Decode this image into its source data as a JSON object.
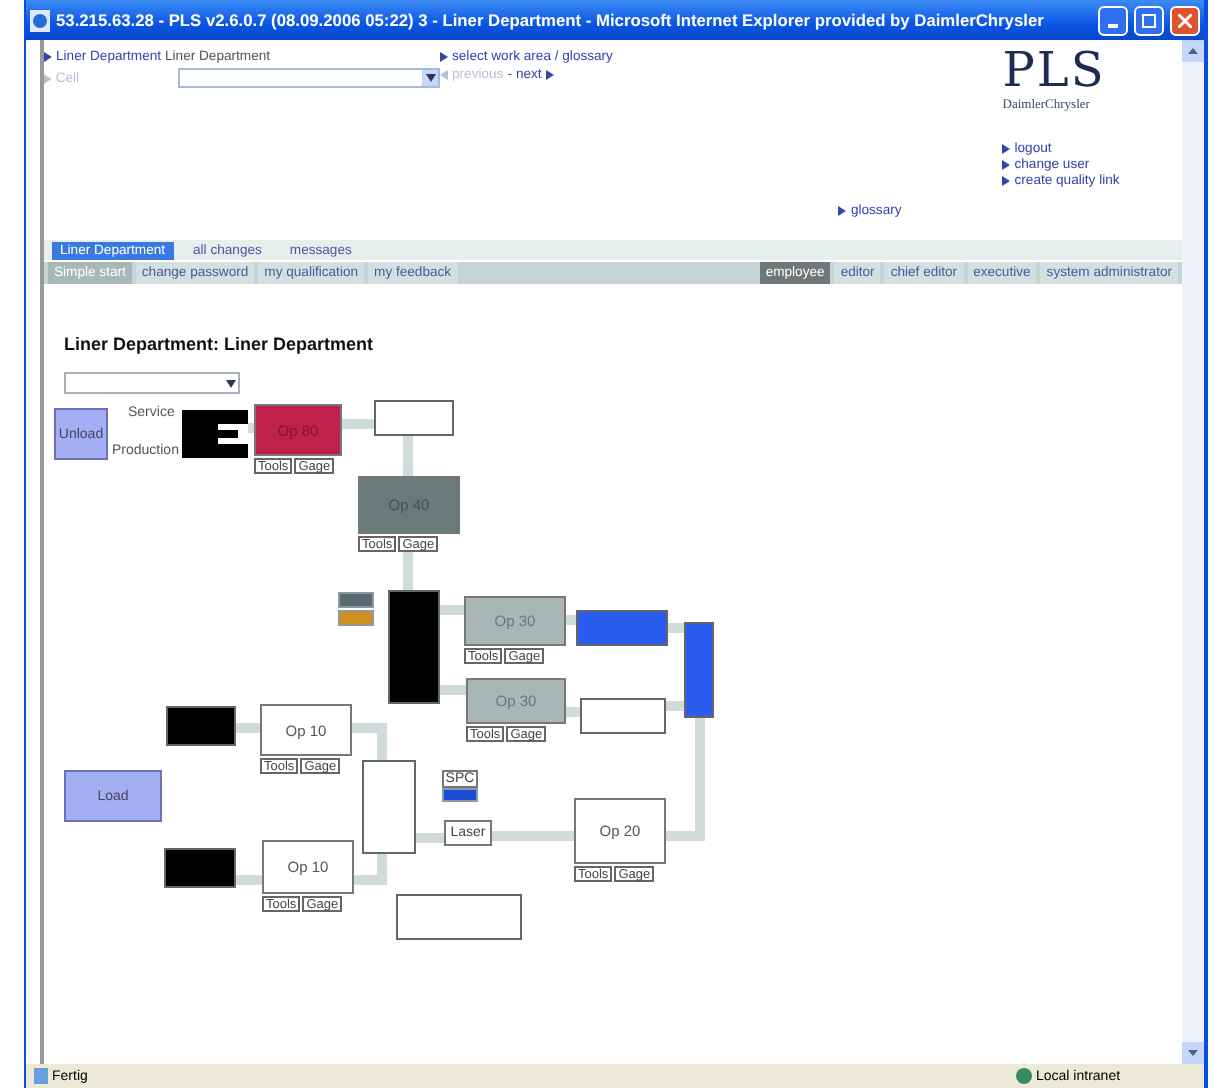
{
  "window": {
    "title": "53.215.63.28 - PLS v2.6.0.7 (08.09.2006 05:22) 3 - Liner Department - Microsoft Internet Explorer provided by DaimlerChrysler"
  },
  "header": {
    "breadcrumb": "Liner Department",
    "breadcrumb_current": "Liner Department",
    "cell_label": "Cell",
    "cell_disabled": true,
    "work_area_link": "select work area / glossary",
    "previous": "previous",
    "previous_disabled": true,
    "separator": "-",
    "next": "next",
    "logo": "PLS",
    "brand": "DaimlerChrysler",
    "links": [
      "logout",
      "change user",
      "create quality link"
    ],
    "glossary": "glossary"
  },
  "main_tabs": [
    {
      "label": "Liner Department",
      "selected": true
    },
    {
      "label": "all changes",
      "selected": false
    },
    {
      "label": "messages",
      "selected": false
    }
  ],
  "sub_tabs": [
    {
      "label": "Simple start",
      "selected": true
    },
    {
      "label": "change password",
      "selected": false
    },
    {
      "label": "my qualification",
      "selected": false
    },
    {
      "label": "my feedback",
      "selected": false
    }
  ],
  "role_tabs": [
    {
      "label": "employee",
      "selected": true
    },
    {
      "label": "editor",
      "selected": false
    },
    {
      "label": "chief editor",
      "selected": false
    },
    {
      "label": "executive",
      "selected": false
    },
    {
      "label": "system administrator",
      "selected": false
    }
  ],
  "heading": "Liner Department: Liner Department",
  "diagram": {
    "nodes": [
      {
        "kind": "buffer",
        "label": "Unload",
        "color": "#a4aef4"
      },
      {
        "kind": "text",
        "label": "Service"
      },
      {
        "kind": "text",
        "label": "Production"
      },
      {
        "kind": "notched",
        "color": "#000000"
      },
      {
        "kind": "station",
        "label": "Op 80",
        "color": "#c0204c",
        "tools": "Tools",
        "gage": "Gage"
      },
      {
        "kind": "block",
        "color": "#ffffff"
      },
      {
        "kind": "station",
        "label": "Op 40",
        "color": "#687a7a",
        "tools": "Tools",
        "gage": "Gage"
      },
      {
        "kind": "chip",
        "color": "#5a6a72"
      },
      {
        "kind": "chip",
        "color": "#d09020"
      },
      {
        "kind": "block",
        "color": "#000000"
      },
      {
        "kind": "station",
        "label": "Op 30",
        "color": "#a8b6b6",
        "tools": "Tools",
        "gage": "Gage"
      },
      {
        "kind": "block",
        "color": "#2a5cf0"
      },
      {
        "kind": "block",
        "color": "#2a5cf0"
      },
      {
        "kind": "station",
        "label": "Op 30",
        "color": "#a8b6b6",
        "tools": "Tools",
        "gage": "Gage"
      },
      {
        "kind": "block",
        "color": "#ffffff"
      },
      {
        "kind": "block",
        "color": "#000000"
      },
      {
        "kind": "station",
        "label": "Op 10",
        "color": "#ffffff",
        "tools": "Tools",
        "gage": "Gage"
      },
      {
        "kind": "buffer",
        "label": "Load",
        "color": "#a4aef4"
      },
      {
        "kind": "block",
        "color": "#ffffff"
      },
      {
        "kind": "tag",
        "label": "SPC"
      },
      {
        "kind": "chip",
        "color": "#1a50d8"
      },
      {
        "kind": "tag",
        "label": "Laser"
      },
      {
        "kind": "station",
        "label": "Op 20",
        "color": "#ffffff",
        "tools": "Tools",
        "gage": "Gage"
      },
      {
        "kind": "block",
        "color": "#000000"
      },
      {
        "kind": "station",
        "label": "Op 10",
        "color": "#ffffff",
        "tools": "Tools",
        "gage": "Gage"
      },
      {
        "kind": "block",
        "color": "#ffffff"
      }
    ]
  },
  "status_bar": {
    "text": "Fertig",
    "zone": "Local intranet"
  }
}
